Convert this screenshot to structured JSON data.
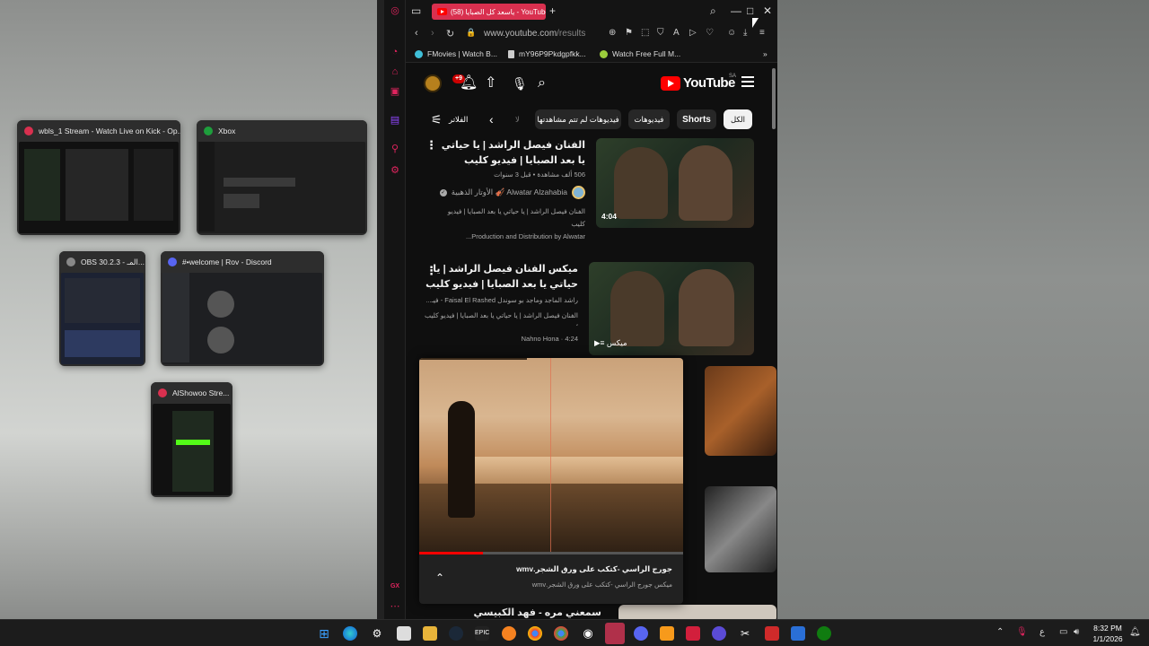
{
  "task_view": {
    "windows": [
      {
        "title": "wbls_1 Stream - Watch Live on Kick - Op...",
        "icon_color": "#d9304f"
      },
      {
        "title": "Xbox",
        "icon_color": "#1e9e3c"
      },
      {
        "title": "OBS 30.2.3 - المـ...",
        "icon_color": "#888888"
      },
      {
        "title": "#•welcome | Rov - Discord",
        "icon_color": "#5865f2"
      },
      {
        "title": "AlShowoo Stre...",
        "icon_color": "#d9304f"
      }
    ]
  },
  "browser": {
    "tab_title": "(58) ياسعد كل الصبايا - YouTube",
    "url_host": "www.youtube.com",
    "url_path": "/results",
    "bookmarks": [
      {
        "label": "FMovies | Watch B...",
        "color": "#3fbfd8"
      },
      {
        "label": "mY96P9Pkdgpfkk...",
        "color": "#cccccc"
      },
      {
        "label": "Watch Free Full M...",
        "color": "#9ccc3c"
      }
    ],
    "sidebar_bottom_label": "GX"
  },
  "youtube": {
    "logo_text": "YouTube",
    "country": "SA",
    "notifications_badge": "+9",
    "chips": {
      "all": "الكل",
      "shorts": "Shorts",
      "videos": "فيديوهات",
      "unwatched": "فيديوهات لم تتم مشاهدتها",
      "partial": "لا",
      "filters": "الفلاتر"
    },
    "results": [
      {
        "title": "الفنان فيصل الراشد | يا حياتي يا بعد الصبايا | فيديو كليب",
        "meta": "506 ألف مشاهدة • قبل 3 سنوات",
        "channel": "Alwatar Alzahabia 🎻 الأوتار الذهبية",
        "description_line1": "الفنان فيصل الراشد | يا حياتي يا بعد الصبايا | فيديو كليب",
        "description_line2": "Production and Distribution by Alwatar...",
        "duration": "4:04"
      },
      {
        "title": "ميكس الفنان فيصل الراشد | يا حياتي يا بعد الصبايا | فيديو كليب",
        "line2": "راشد الماجد وماجد بو سوندل Faisal El Rashed - فيـ...",
        "line3": "الفنان فيصل الراشد | يا حياتي يا بعد الصبايا | فيديو كليب ،",
        "line4": "Nahno Hona · 4:24",
        "badge": "ميكس"
      }
    ],
    "mini_player": {
      "title": "جورج الراسي -كتكب على ورق الشجر.wmv",
      "subtitle": "ميكس جورج الراسي -كتكب على ورق الشجر.wmv",
      "progress": 0.24
    },
    "bottom_partial_title": "سمعني مره - فهد الكبيسي"
  },
  "taskbar": {
    "time": "8:32 PM",
    "date": "1/1/2026",
    "lang": "ع"
  }
}
